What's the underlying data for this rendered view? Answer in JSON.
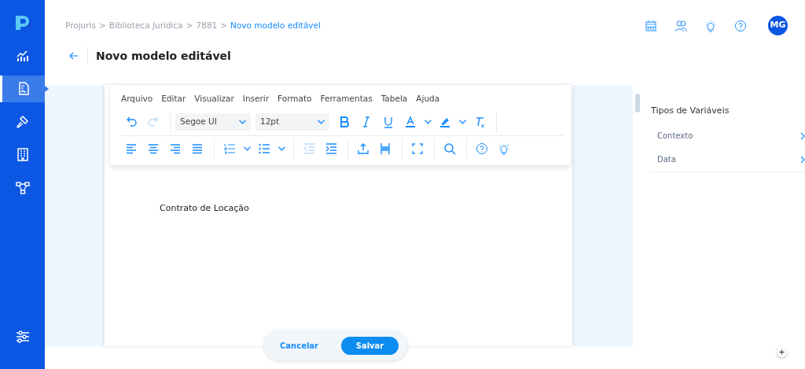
{
  "sidebar": {
    "items": [
      {
        "kind": "chart",
        "selected": false
      },
      {
        "kind": "document",
        "selected": true
      },
      {
        "kind": "gavel",
        "selected": false
      },
      {
        "kind": "building",
        "selected": false
      },
      {
        "kind": "network",
        "selected": false
      }
    ],
    "bottom_items": [
      {
        "kind": "sliders",
        "selected": false
      }
    ]
  },
  "breadcrumb_separator": ">",
  "breadcrumb": [
    {
      "label": "Projuris",
      "current": false
    },
    {
      "label": "Biblioteca Jurídica",
      "current": false
    },
    {
      "label": "7881",
      "current": false
    },
    {
      "label": "Novo modelo editável",
      "current": true
    }
  ],
  "header_icons": [
    {
      "kind": "calendar"
    },
    {
      "kind": "users"
    },
    {
      "kind": "bulb"
    },
    {
      "kind": "help"
    }
  ],
  "avatar": {
    "initials": "MG"
  },
  "page_title": "Novo modelo editável",
  "editor": {
    "menu": [
      "Arquivo",
      "Editar",
      "Visualizar",
      "Inserir",
      "Formato",
      "Ferramentas",
      "Tabela",
      "Ajuda"
    ],
    "toolbar_rows": [
      [
        {
          "kind": "undo",
          "disabled": false
        },
        {
          "kind": "redo",
          "disabled": true
        },
        {
          "kind": "separator"
        },
        {
          "kind": "select",
          "value": "Segoe UI"
        },
        {
          "kind": "select",
          "value": "12pt"
        },
        {
          "kind": "bold",
          "disabled": false
        },
        {
          "kind": "italic",
          "disabled": false
        },
        {
          "kind": "underline",
          "disabled": false
        },
        {
          "kind": "textcolor",
          "disabled": false
        },
        {
          "kind": "caret",
          "disabled": false
        },
        {
          "kind": "highlight",
          "disabled": false
        },
        {
          "kind": "caret",
          "disabled": false
        },
        {
          "kind": "clearformat",
          "disabled": false
        },
        {
          "kind": "separator"
        }
      ],
      [
        {
          "kind": "alignleft",
          "disabled": false
        },
        {
          "kind": "aligncenter",
          "disabled": false
        },
        {
          "kind": "alignright",
          "disabled": false
        },
        {
          "kind": "justify",
          "disabled": false
        },
        {
          "kind": "separator"
        },
        {
          "kind": "numlist",
          "disabled": false
        },
        {
          "kind": "caret",
          "disabled": false
        },
        {
          "kind": "bullist",
          "disabled": false
        },
        {
          "kind": "caret",
          "disabled": false
        },
        {
          "kind": "separator"
        },
        {
          "kind": "outdent",
          "disabled": true
        },
        {
          "kind": "indent",
          "disabled": false
        },
        {
          "kind": "separator"
        },
        {
          "kind": "insert",
          "disabled": false
        },
        {
          "kind": "pagebreak",
          "disabled": false
        },
        {
          "kind": "separator"
        },
        {
          "kind": "fullscreen",
          "disabled": false
        },
        {
          "kind": "separator"
        },
        {
          "kind": "search",
          "disabled": false
        },
        {
          "kind": "separator"
        },
        {
          "kind": "help",
          "disabled": false
        },
        {
          "kind": "bulb",
          "disabled": false
        }
      ]
    ],
    "content": "Contrato de Locação"
  },
  "variables_panel": {
    "title": "Tipos de Variáveis",
    "items": [
      "Contexto",
      "Data"
    ]
  },
  "actions": {
    "cancel": "Cancelar",
    "save": "Salvar"
  },
  "corner_button": "+"
}
